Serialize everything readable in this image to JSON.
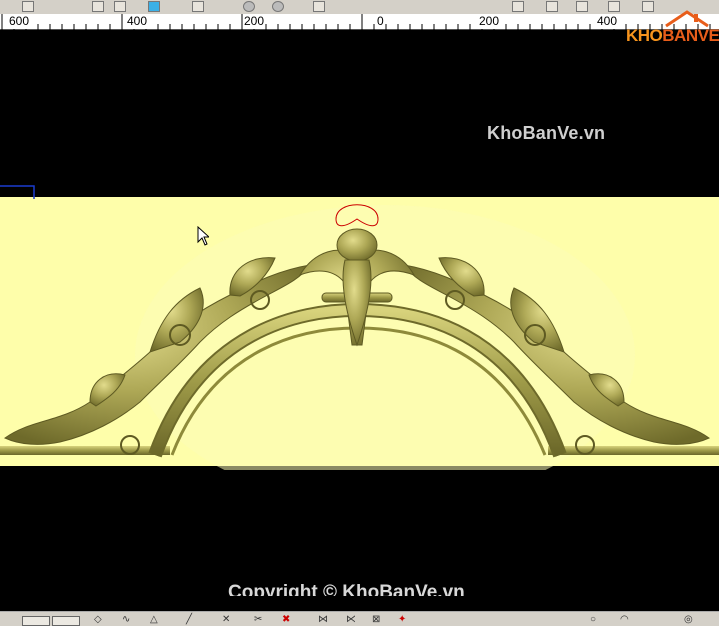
{
  "ruler": {
    "labels": [
      "600",
      "400",
      "200",
      "0",
      "200",
      "400"
    ]
  },
  "viewport": {
    "watermark": "KhoBanVe.vn",
    "footer_watermark": "Copyright © KhoBanVe.vn"
  },
  "logo": {
    "kho": "KHO",
    "banve": "BANVE"
  },
  "colors": {
    "canvas_background": "#000000",
    "relief_background": "#fefeaa",
    "relief_ornament": "#a9a550",
    "selection_outline": "#cc0000"
  },
  "icons": {
    "top_toolbar": [
      "scissors-icon",
      "copy-icon",
      "paste-icon",
      "cube-icon",
      "layers-icon",
      "sphere-icon",
      "sphere-icon",
      "transform-icon",
      "view-icon",
      "rotate-icon",
      "rotate-icon",
      "view-icon",
      "home-icon"
    ],
    "bottom_toolbar": [
      "select-icon",
      "select-icon",
      "polygon-icon",
      "curve-icon",
      "shape-icon",
      "line-icon",
      "node-icon",
      "delete-node-icon",
      "delete-icon",
      "vector-icon",
      "vector-icon",
      "weld-icon",
      "trim-icon",
      "circle-icon",
      "arc-icon",
      "offset-icon"
    ]
  }
}
